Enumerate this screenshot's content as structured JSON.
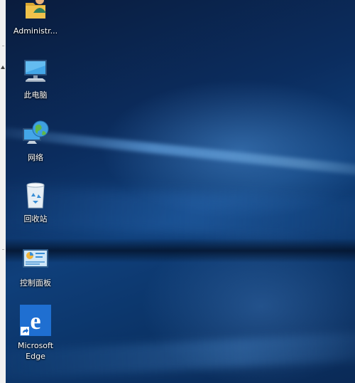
{
  "desktop": {
    "icons": [
      {
        "label": "Administr...",
        "icon": "user-folder-icon"
      },
      {
        "label": "此电脑",
        "icon": "computer-icon"
      },
      {
        "label": "网络",
        "icon": "network-globe-icon"
      },
      {
        "label": "回收站",
        "icon": "recycle-bin-icon"
      },
      {
        "label": "控制面板",
        "icon": "control-panel-icon"
      },
      {
        "label": "Microsoft Edge",
        "icon": "edge-icon",
        "shortcut": true
      }
    ]
  },
  "colors": {
    "wallpaper_dark": "#0a1c3d",
    "wallpaper_mid": "#0f3f7a",
    "wallpaper_light_beam": "#78beff",
    "edge_blue": "#1f6fd1",
    "folder_yellow": "#f0c24b"
  }
}
